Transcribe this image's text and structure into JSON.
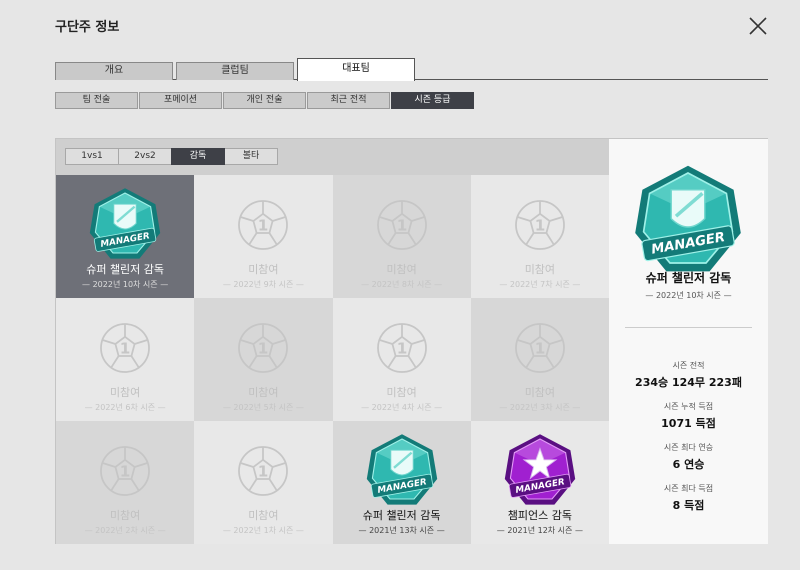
{
  "window": {
    "title": "구단주 정보"
  },
  "main_tabs": [
    {
      "label": "개요",
      "active": false
    },
    {
      "label": "클럽팀",
      "active": false
    },
    {
      "label": "대표팀",
      "active": true
    }
  ],
  "sub_tabs": [
    {
      "label": "팀 전술",
      "active": false
    },
    {
      "label": "포메이션",
      "active": false
    },
    {
      "label": "개인 전술",
      "active": false
    },
    {
      "label": "최근 전적",
      "active": false
    },
    {
      "label": "시즌 등급",
      "active": true
    }
  ],
  "filters": [
    {
      "label": "1vs1",
      "active": false
    },
    {
      "label": "2vs2",
      "active": false
    },
    {
      "label": "감독",
      "active": true
    },
    {
      "label": "볼타",
      "active": false
    }
  ],
  "badges": [
    {
      "label": "슈퍼 챌린저 감독",
      "season": "— 2022년 10차 시즌 —",
      "type": "challenger",
      "state": "selected"
    },
    {
      "label": "미참여",
      "season": "— 2022년 9차 시즌 —",
      "type": "none",
      "state": "none"
    },
    {
      "label": "미참여",
      "season": "— 2022년 8차 시즌 —",
      "type": "none",
      "state": "none"
    },
    {
      "label": "미참여",
      "season": "— 2022년 7차 시즌 —",
      "type": "none",
      "state": "none"
    },
    {
      "label": "미참여",
      "season": "— 2022년 6차 시즌 —",
      "type": "none",
      "state": "none"
    },
    {
      "label": "미참여",
      "season": "— 2022년 5차 시즌 —",
      "type": "none",
      "state": "none"
    },
    {
      "label": "미참여",
      "season": "— 2022년 4차 시즌 —",
      "type": "none",
      "state": "none"
    },
    {
      "label": "미참여",
      "season": "— 2022년 3차 시즌 —",
      "type": "none",
      "state": "none"
    },
    {
      "label": "미참여",
      "season": "— 2022년 2차 시즌 —",
      "type": "none",
      "state": "none"
    },
    {
      "label": "미참여",
      "season": "— 2022년 1차 시즌 —",
      "type": "none",
      "state": "none"
    },
    {
      "label": "슈퍼 챌린저 감독",
      "season": "— 2021년 13차 시즌 —",
      "type": "challenger",
      "state": "earned"
    },
    {
      "label": "챔피언스 감독",
      "season": "— 2021년 12차 시즌 —",
      "type": "champions",
      "state": "earned"
    }
  ],
  "emblem_text": "MANAGER",
  "side_panel": {
    "name": "슈퍼 챌린저 감독",
    "season": "— 2022년 10차 시즌 —",
    "stats": [
      {
        "label": "시즌 전적",
        "value": "234승 124무 223패"
      },
      {
        "label": "시즌 누적 득점",
        "value": "1071 득점"
      },
      {
        "label": "시즌 최다 연승",
        "value": "6 연승"
      },
      {
        "label": "시즌 최다 득점",
        "value": "8 득점"
      }
    ]
  },
  "colors": {
    "challenger": "#2fb8b0",
    "champions": "#a020d0",
    "selected_cell": "#6e7078",
    "active_tab": "#3e4047"
  }
}
